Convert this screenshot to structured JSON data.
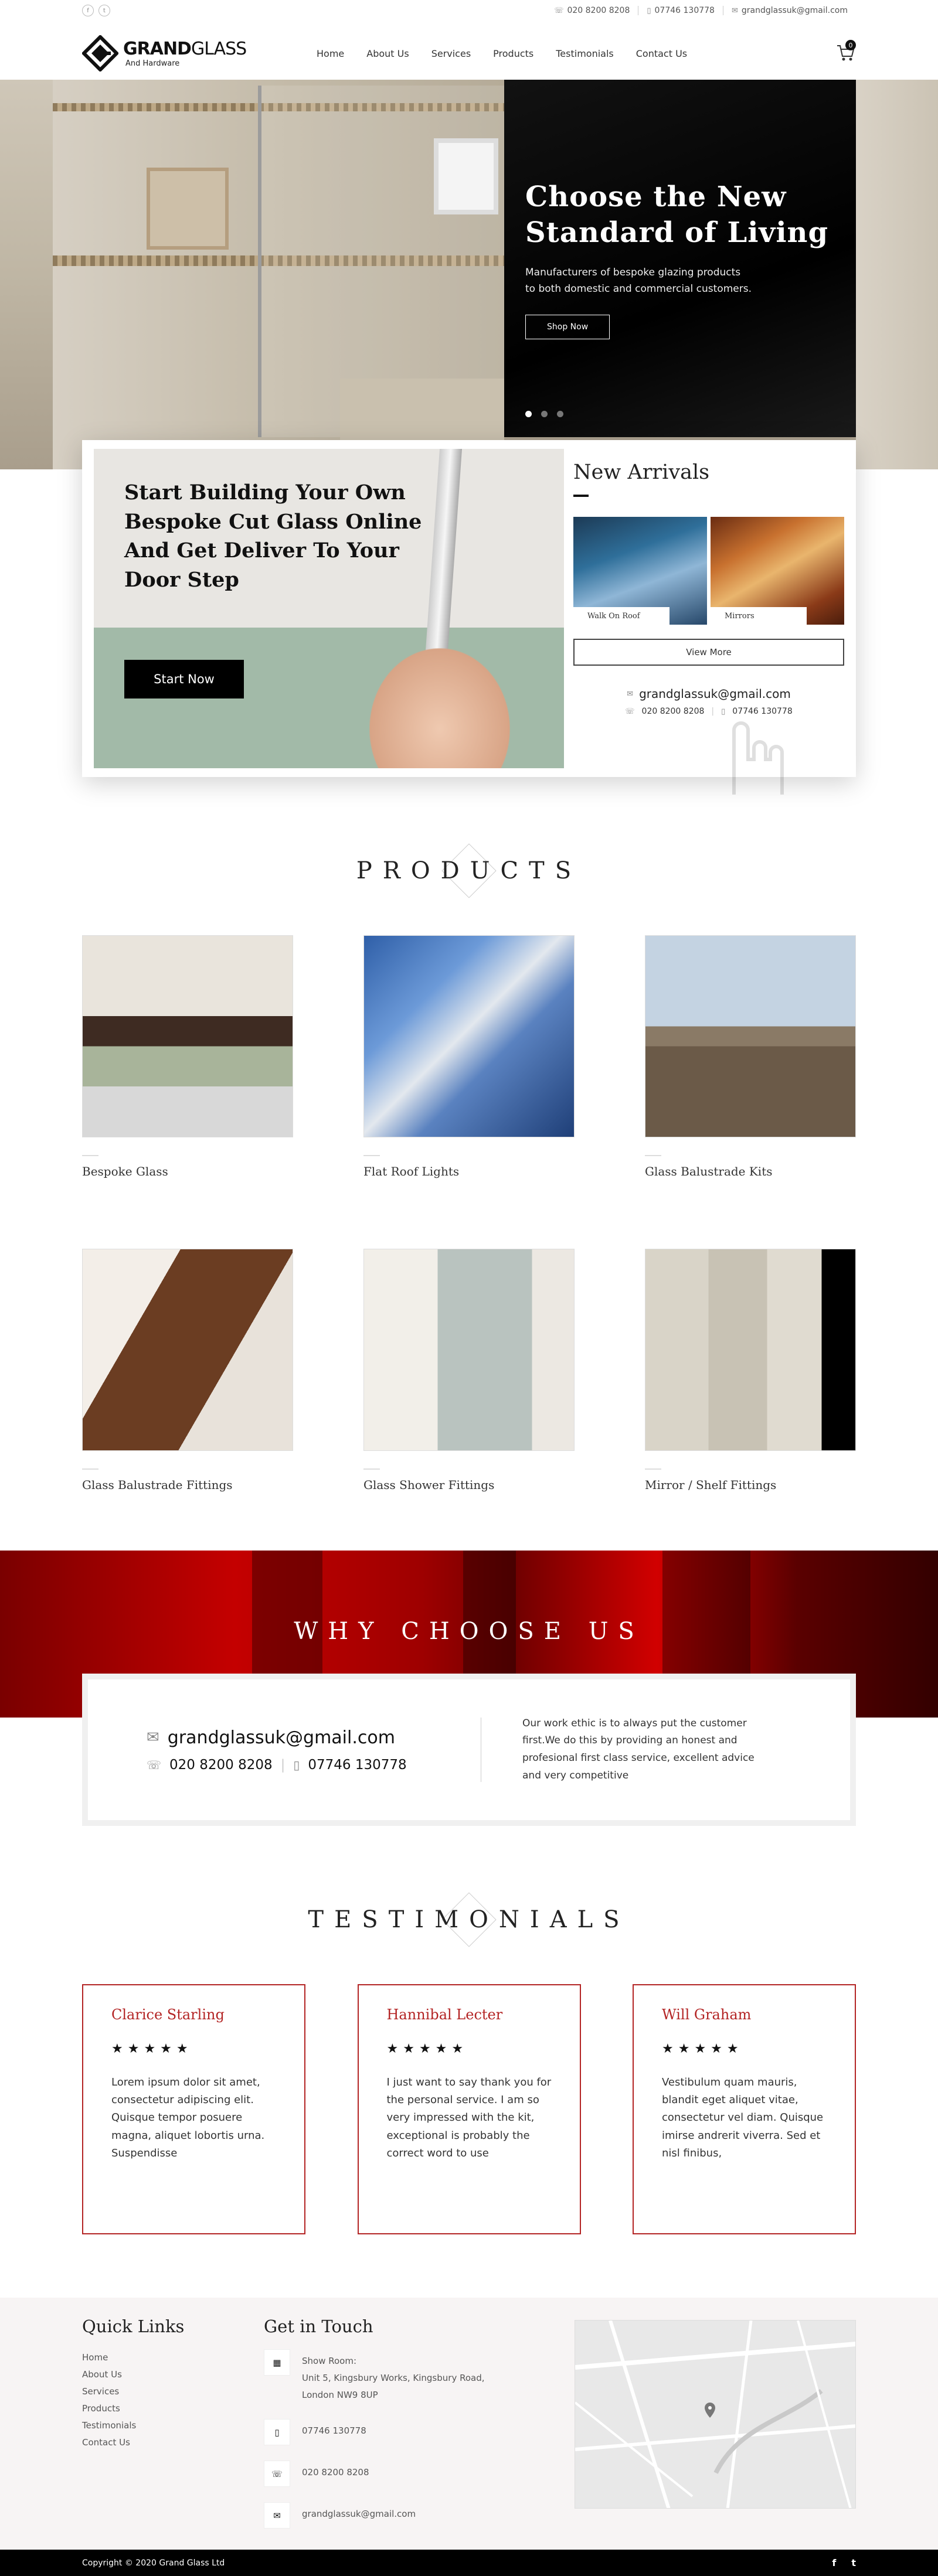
{
  "topbar": {
    "social": [
      "f",
      "t"
    ],
    "phone": "020 8200 8208",
    "mobile": "07746 130778",
    "email": "grandglassuk@gmail.com"
  },
  "logo": {
    "brand_bold": "GRAND",
    "brand_light": "GLASS",
    "tagline": "And Hardware"
  },
  "nav": [
    "Home",
    "About Us",
    "Services",
    "Products",
    "Testimonials",
    "Contact Us"
  ],
  "cart": {
    "count": "0"
  },
  "hero": {
    "title_line1": "Choose the New",
    "title_line2": "Standard of Living",
    "subtitle_line1": "Manufacturers of bespoke glazing products",
    "subtitle_line2": "to both domestic and commercial customers.",
    "button": "Shop Now"
  },
  "intro": {
    "heading": "Start Building Your Own Bespoke Cut Glass Online And Get Deliver To Your Door Step",
    "button": "Start Now"
  },
  "arrivals": {
    "title": "New Arrivals",
    "items": [
      {
        "label": "Walk On Roof"
      },
      {
        "label": "Mirrors"
      }
    ],
    "view_more": "View More",
    "email": "grandglassuk@gmail.com",
    "phone": "020 8200 8208",
    "mobile": "07746 130778"
  },
  "products": {
    "title": "PRODUCTS",
    "items": [
      "Bespoke Glass",
      "Flat Roof Lights",
      "Glass Balustrade Kits",
      "Glass Balustrade Fittings",
      "Glass Shower Fittings",
      "Mirror / Shelf Fittings"
    ]
  },
  "why": {
    "title": "WHY CHOOSE US",
    "email": "grandglassuk@gmail.com",
    "phone": "020 8200 8208",
    "mobile": "07746 130778",
    "text": "Our work ethic is to always put the customer first.We do this by providing an honest and profesional first class service, excellent advice and very competitive"
  },
  "testimonials": {
    "title": "TESTIMONIALS",
    "items": [
      {
        "name": "Clarice Starling",
        "stars": "★★★★★",
        "text": "Lorem ipsum dolor sit amet, consectetur adipiscing elit. Quisque tempor posuere magna, aliquet lobortis urna. Suspendisse"
      },
      {
        "name": "Hannibal Lecter",
        "stars": "★★★★★",
        "text": "I just want to say thank you for the personal service. I am so very impressed with the kit, exceptional is probably the correct word to use"
      },
      {
        "name": "Will Graham",
        "stars": "★★★★★",
        "text": "Vestibulum quam mauris, blandit eget aliquet vitae, consectetur vel diam. Quisque imirse andrerit viverra. Sed et nisl finibus,"
      }
    ]
  },
  "footer": {
    "quick_links_title": "Quick Links",
    "links": [
      "Home",
      "About Us",
      "Services",
      "Products",
      "Testimonials",
      "Contact Us"
    ],
    "get_in_touch_title": "Get in Touch",
    "showroom_label": "Show Room:",
    "address_line1": "Unit 5, Kingsbury Works, Kingsbury Road,",
    "address_line2": "London NW9 8UP",
    "mobile": "07746 130778",
    "phone": "020 8200 8208",
    "email": "grandglassuk@gmail.com",
    "copyright": "Copyright © 2020 Grand Glass Ltd",
    "bottom_social": [
      "f",
      "t"
    ]
  },
  "colors": {
    "accent_red": "#b32424",
    "dark": "#000000",
    "footer_bg": "#f7f4f4"
  }
}
